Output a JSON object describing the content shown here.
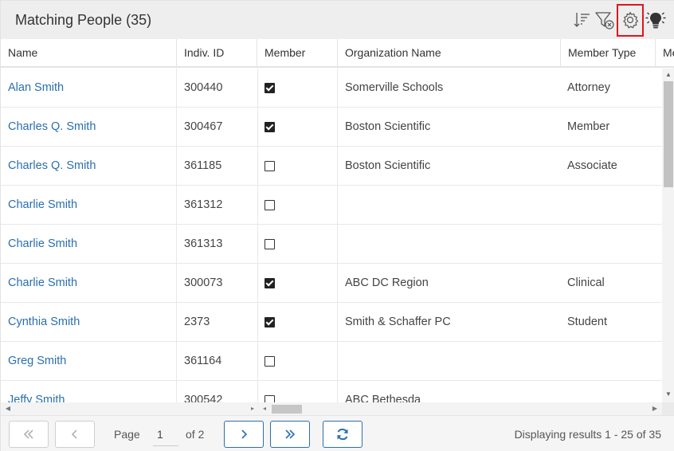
{
  "header": {
    "title": "Matching People (35)",
    "icons": [
      "sort-icon",
      "clear-filter-icon",
      "settings-gear-icon",
      "lightbulb-icon"
    ]
  },
  "columns": [
    {
      "label": "Name"
    },
    {
      "label": "Indiv. ID"
    },
    {
      "label": "Member"
    },
    {
      "label": "Organization Name"
    },
    {
      "label": "Member Type"
    },
    {
      "label": "Me"
    }
  ],
  "rows": [
    {
      "name": "Alan Smith",
      "id": "300440",
      "member": true,
      "org": "Somerville Schools",
      "type": "Attorney"
    },
    {
      "name": "Charles Q. Smith",
      "id": "300467",
      "member": true,
      "org": "Boston Scientific",
      "type": "Member"
    },
    {
      "name": "Charles Q. Smith",
      "id": "361185",
      "member": false,
      "org": "Boston Scientific",
      "type": "Associate"
    },
    {
      "name": "Charlie Smith",
      "id": "361312",
      "member": false,
      "org": "",
      "type": ""
    },
    {
      "name": "Charlie Smith",
      "id": "361313",
      "member": false,
      "org": "",
      "type": ""
    },
    {
      "name": "Charlie Smith",
      "id": "300073",
      "member": true,
      "org": "ABC DC Region",
      "type": "Clinical"
    },
    {
      "name": "Cynthia Smith",
      "id": "2373",
      "member": true,
      "org": "Smith & Schaffer PC",
      "type": "Student"
    },
    {
      "name": "Greg Smith",
      "id": "361164",
      "member": false,
      "org": "",
      "type": ""
    },
    {
      "name": "Jeffy Smith",
      "id": "300542",
      "member": false,
      "org": "ABC Bethesda",
      "type": ""
    }
  ],
  "pager": {
    "page_label": "Page",
    "page_value": "1",
    "of_label": "of 2",
    "info": "Displaying results 1 - 25 of 35",
    "colors": {
      "accent": "#2a6fae",
      "highlight": "#e0151c"
    }
  }
}
